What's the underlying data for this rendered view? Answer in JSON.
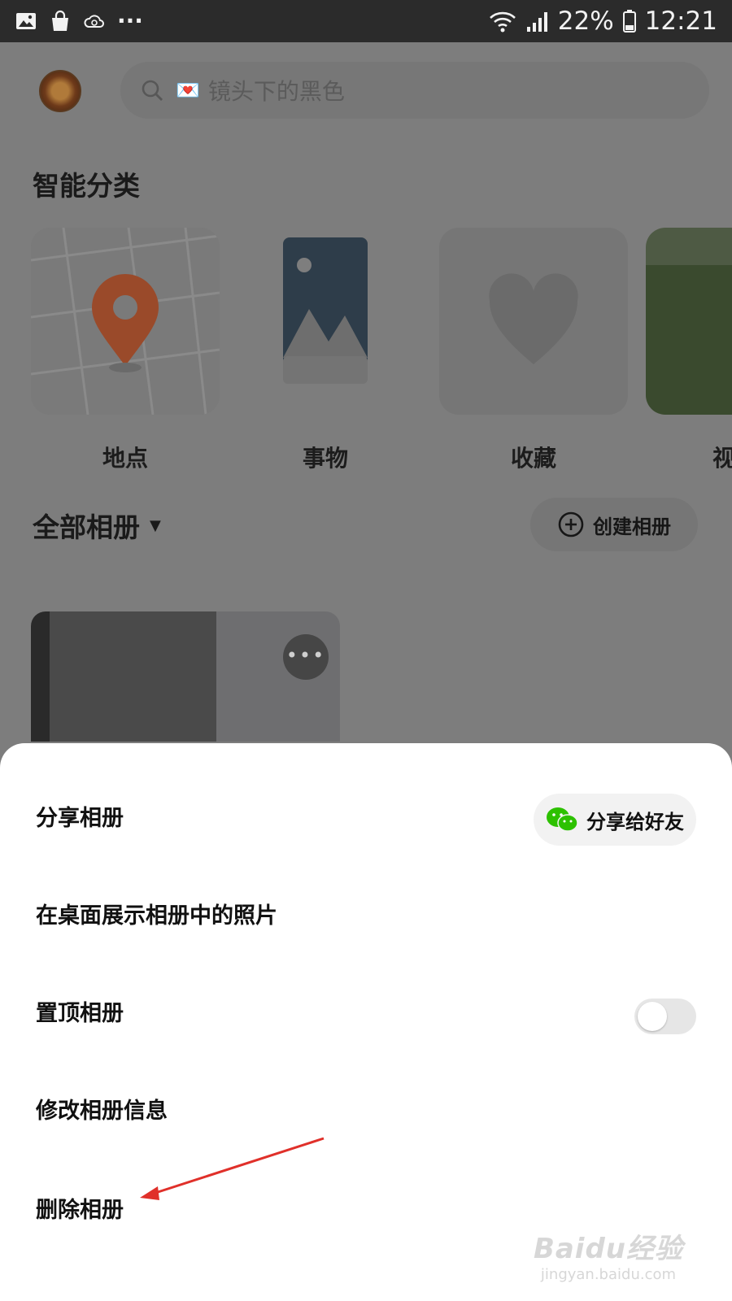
{
  "status_bar": {
    "left_icons": [
      "gallery-icon",
      "shopping-bag-icon",
      "cloud-sync-icon",
      "more-dots-icon"
    ],
    "more_label": "···",
    "battery": "22%",
    "time": "12:21"
  },
  "header": {
    "search_emoji": "💌",
    "search_placeholder": "镜头下的黑色"
  },
  "smart_categories": {
    "title": "智能分类",
    "items": [
      {
        "label": "地点",
        "icon": "map-pin-icon"
      },
      {
        "label": "事物",
        "icon": "landscape-icon"
      },
      {
        "label": "收藏",
        "icon": "heart-icon"
      },
      {
        "label": "视",
        "icon": "photo-thumbnail"
      }
    ]
  },
  "albums": {
    "title": "全部相册",
    "dropdown_icon": "▼",
    "create_label": "创建相册",
    "more_dots": "•••"
  },
  "bottom_sheet": {
    "share_album": "分享相册",
    "share_friend": "分享给好友",
    "show_on_desktop": "在桌面展示相册中的照片",
    "pin_album": "置顶相册",
    "pin_enabled": false,
    "edit_info": "修改相册信息",
    "delete_album": "删除相册"
  },
  "watermark": {
    "main": "Baidu经验",
    "sub": "jingyan.baidu.com"
  },
  "colors": {
    "annotation_arrow": "#e0302a",
    "wechat_green": "#2dc100"
  }
}
